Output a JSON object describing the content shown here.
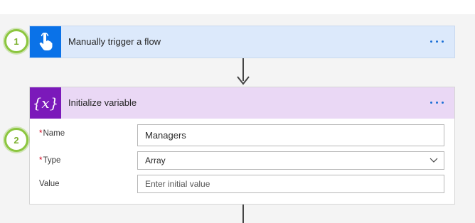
{
  "steps": [
    {
      "badge": "1"
    },
    {
      "badge": "2"
    }
  ],
  "trigger": {
    "title": "Manually trigger a flow",
    "icon": "touch-hand-icon"
  },
  "variable": {
    "title": "Initialize variable",
    "icon_text": "{x}",
    "fields": {
      "name": {
        "required_mark": "*",
        "label": "Name",
        "value": "Managers"
      },
      "type": {
        "required_mark": "*",
        "label": "Type",
        "value": "Array"
      },
      "value": {
        "label": "Value",
        "placeholder": "Enter initial value"
      }
    }
  },
  "colors": {
    "trigger_accent": "#0a72e8",
    "variable_accent": "#7b19ba",
    "badge": "#8cc63f"
  }
}
